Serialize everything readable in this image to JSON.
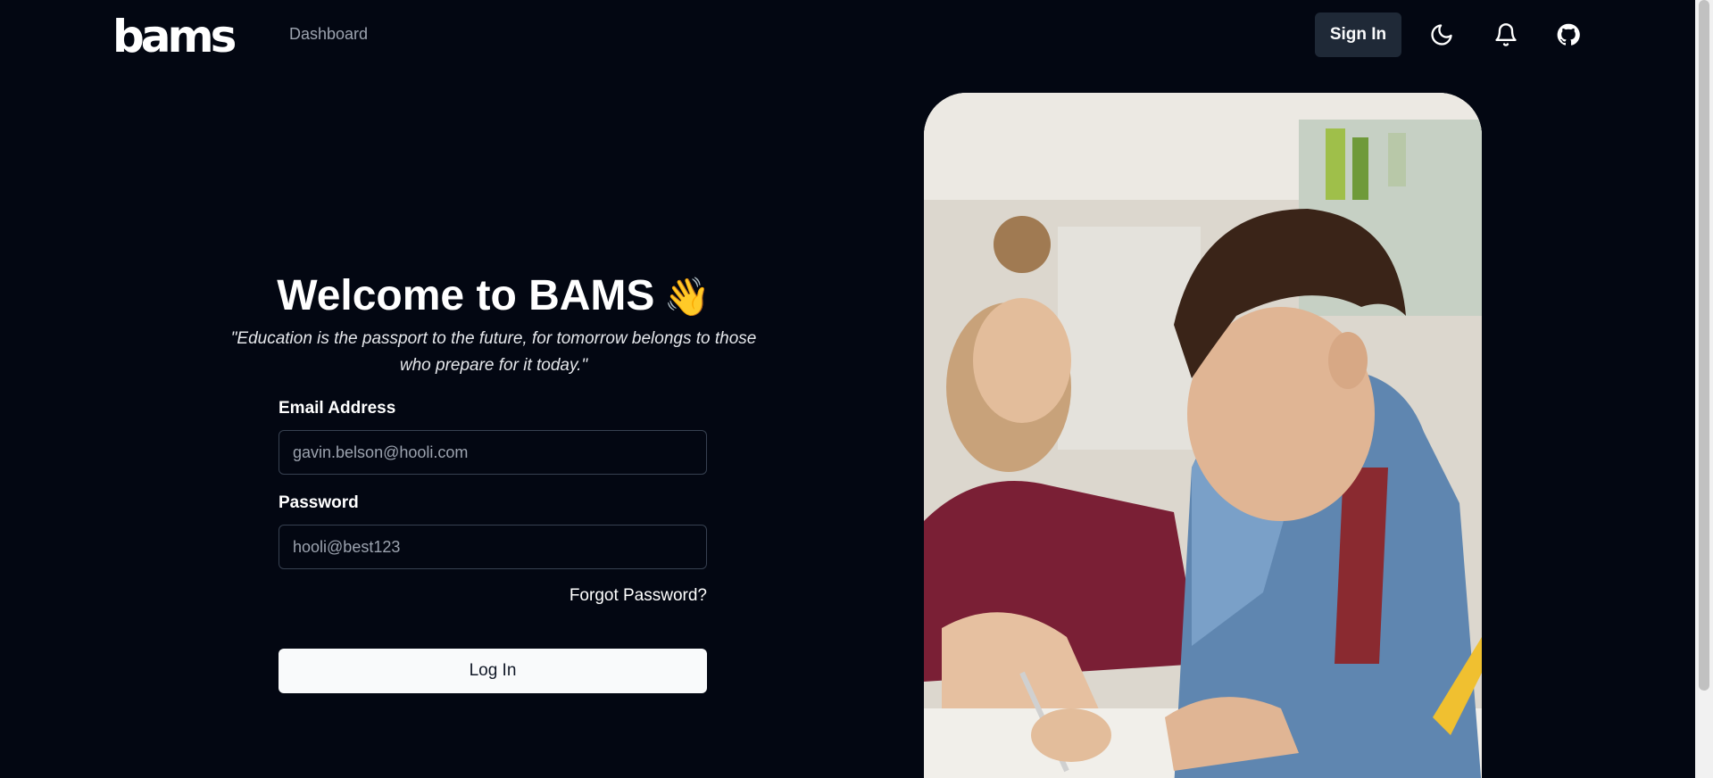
{
  "nav": {
    "logo": "bams",
    "dashboard_link": "Dashboard",
    "signin_label": "Sign In",
    "icons": [
      "moon-icon",
      "bell-icon",
      "github-icon"
    ]
  },
  "welcome": {
    "title": "Welcome to BAMS",
    "emoji": "👋",
    "quote": "\"Education is the passport to the future, for tomorrow belongs to those who prepare for it today.\""
  },
  "form": {
    "email_label": "Email Address",
    "email_placeholder": "gavin.belson@hooli.com",
    "password_label": "Password",
    "password_placeholder": "hooli@best123",
    "forgot_label": "Forgot Password?",
    "login_label": "Log In"
  },
  "colors": {
    "background": "#030712",
    "signin_bg": "#1f2937",
    "login_bg": "#f9fafb",
    "muted_text": "#9ca3af"
  }
}
